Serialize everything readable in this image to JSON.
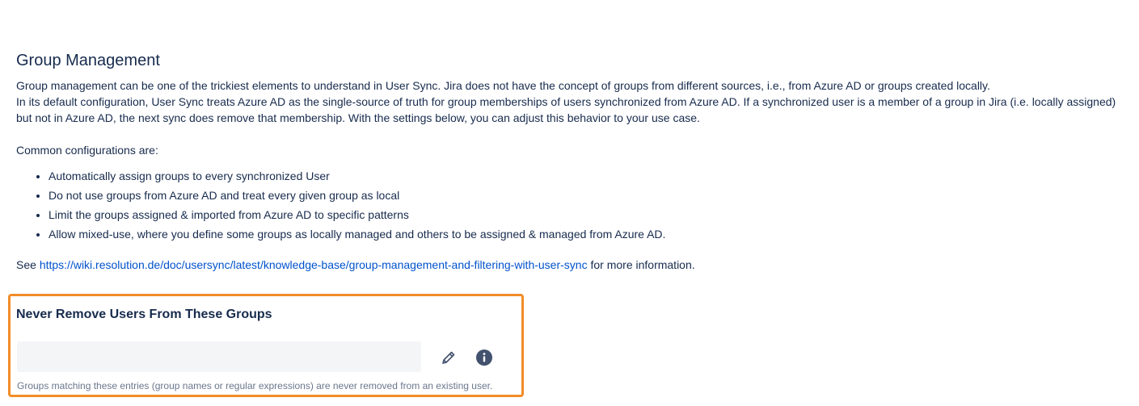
{
  "group_management": {
    "title": "Group Management",
    "intro_line1": "Group management can be one of the trickiest elements to understand in User Sync. Jira does not have the concept of groups from different sources, i.e., from Azure AD or groups created locally.",
    "intro_line2": "In its default configuration, User Sync treats Azure AD as the single-source of truth for group memberships of users synchronized from Azure AD. If a synchronized user is a member of a group in Jira (i.e. locally assigned) but not in Azure AD, the next sync does remove that membership. With the settings below, you can adjust this behavior to your use case.",
    "common_configs_label": "Common configurations are:",
    "bullets": [
      "Automatically assign groups to every synchronized User",
      "Do not use groups from Azure AD and treat every given group as local",
      "Limit the groups assigned & imported from Azure AD to specific patterns",
      "Allow mixed-use, where you define some groups as locally managed and others to be assigned & managed from Azure AD."
    ],
    "see_prefix": "See ",
    "link_text": "https://wiki.resolution.de/doc/usersync/latest/knowledge-base/group-management-and-filtering-with-user-sync",
    "see_suffix": " for more information."
  },
  "never_remove": {
    "title": "Never Remove Users From These Groups",
    "input_value": "",
    "input_placeholder": "",
    "helper_text": "Groups matching these entries (group names or regular expressions) are never removed from an existing user.",
    "edit_icon": "pencil-icon",
    "info_icon": "info-icon"
  },
  "colors": {
    "highlight": "#f28c28",
    "link": "#0052cc",
    "text": "#172b4d",
    "muted": "#6b778c",
    "input_bg": "#f4f5f7",
    "icon": "#42526e"
  }
}
